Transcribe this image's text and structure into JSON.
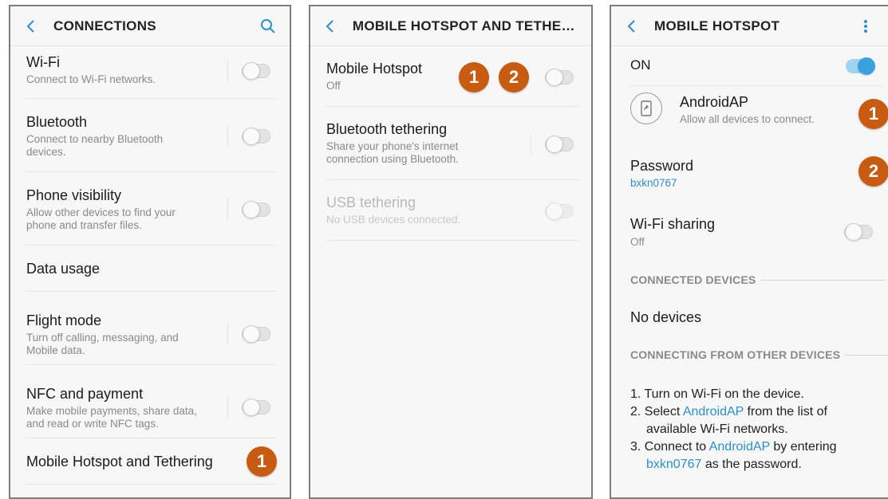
{
  "screen1": {
    "title": "CONNECTIONS",
    "items": [
      {
        "title": "Wi‑Fi",
        "sub": "Connect to Wi‑Fi networks."
      },
      {
        "title": "Bluetooth",
        "sub": "Connect to nearby Bluetooth devices."
      },
      {
        "title": "Phone visibility",
        "sub": "Allow other devices to find your phone and transfer files."
      },
      {
        "title": "Data usage"
      },
      {
        "title": "Flight mode",
        "sub": "Turn off calling, messaging, and Mobile data."
      },
      {
        "title": "NFC and payment",
        "sub": "Make mobile payments, share data, and read or write NFC tags."
      },
      {
        "title": "Mobile Hotspot and Tethering"
      }
    ],
    "badge": "1"
  },
  "screen2": {
    "title": "MOBILE HOTSPOT AND TETHERI…",
    "items": [
      {
        "title": "Mobile Hotspot",
        "sub": "Off"
      },
      {
        "title": "Bluetooth tethering",
        "sub": "Share your phone's internet connection using Bluetooth."
      },
      {
        "title": "USB tethering",
        "sub": "No USB devices connected."
      }
    ],
    "badge1": "1",
    "badge2": "2"
  },
  "screen3": {
    "title": "MOBILE HOTSPOT",
    "on_label": "ON",
    "network_name": "AndroidAP",
    "network_sub": "Allow all devices to connect.",
    "password_label": "Password",
    "password_value": "bxkn0767",
    "wifi_sharing": {
      "title": "Wi‑Fi sharing",
      "sub": "Off"
    },
    "connected_devices_label": "CONNECTED DEVICES",
    "no_devices": "No devices",
    "connecting_label": "CONNECTING FROM OTHER DEVICES",
    "steps": {
      "s1": "1. Turn on Wi‑Fi on the device.",
      "s2_a": "2. Select ",
      "s2_b": "AndroidAP",
      "s2_c": " from the list of",
      "s2_d": "available Wi‑Fi networks.",
      "s3_a": "3. Connect to ",
      "s3_b": "AndroidAP",
      "s3_c": " by entering",
      "s3_d": "bxkn0767",
      "s3_e": " as the password."
    },
    "badge1": "1",
    "badge2": "2"
  },
  "colors": {
    "accent": "#2f8fc9",
    "badge": "#c85b12"
  },
  "icons": {
    "back": "chevron-left-icon",
    "search": "search-icon",
    "more": "more-vertical-icon",
    "share": "share-device-icon"
  }
}
